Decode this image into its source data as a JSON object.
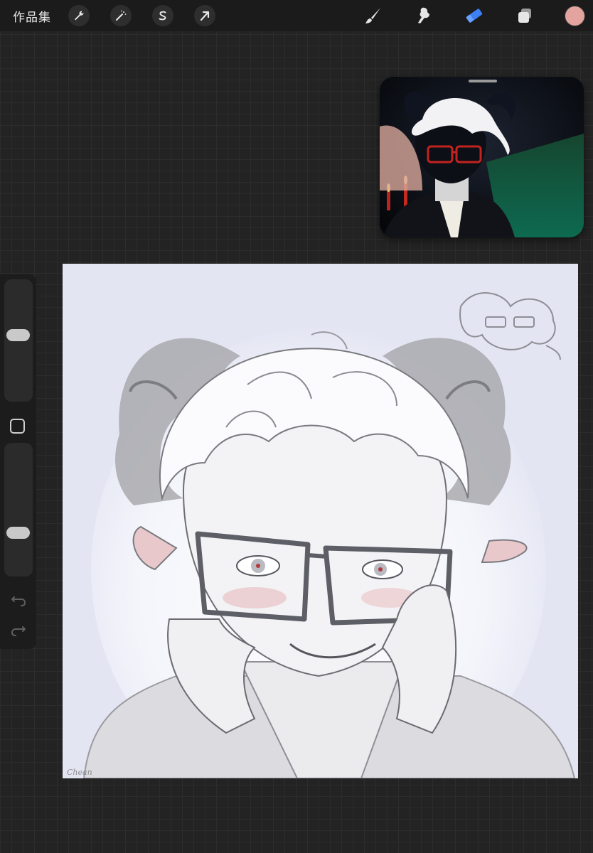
{
  "topbar": {
    "gallery_label": "作品集",
    "left_tools": [
      "wrench-icon",
      "magic-wand-icon",
      "selection-icon",
      "transform-arrow-icon"
    ],
    "right_tools": [
      "brush-icon",
      "smudge-icon",
      "eraser-icon",
      "layers-icon"
    ],
    "active_tool": "eraser-icon",
    "accent_color": "#3d7ff5",
    "current_color": "#e3a39f"
  },
  "sidebar": {
    "brush_size_level": 0.55,
    "opacity_level": 0.3
  },
  "canvas": {
    "signature": "Chean"
  }
}
